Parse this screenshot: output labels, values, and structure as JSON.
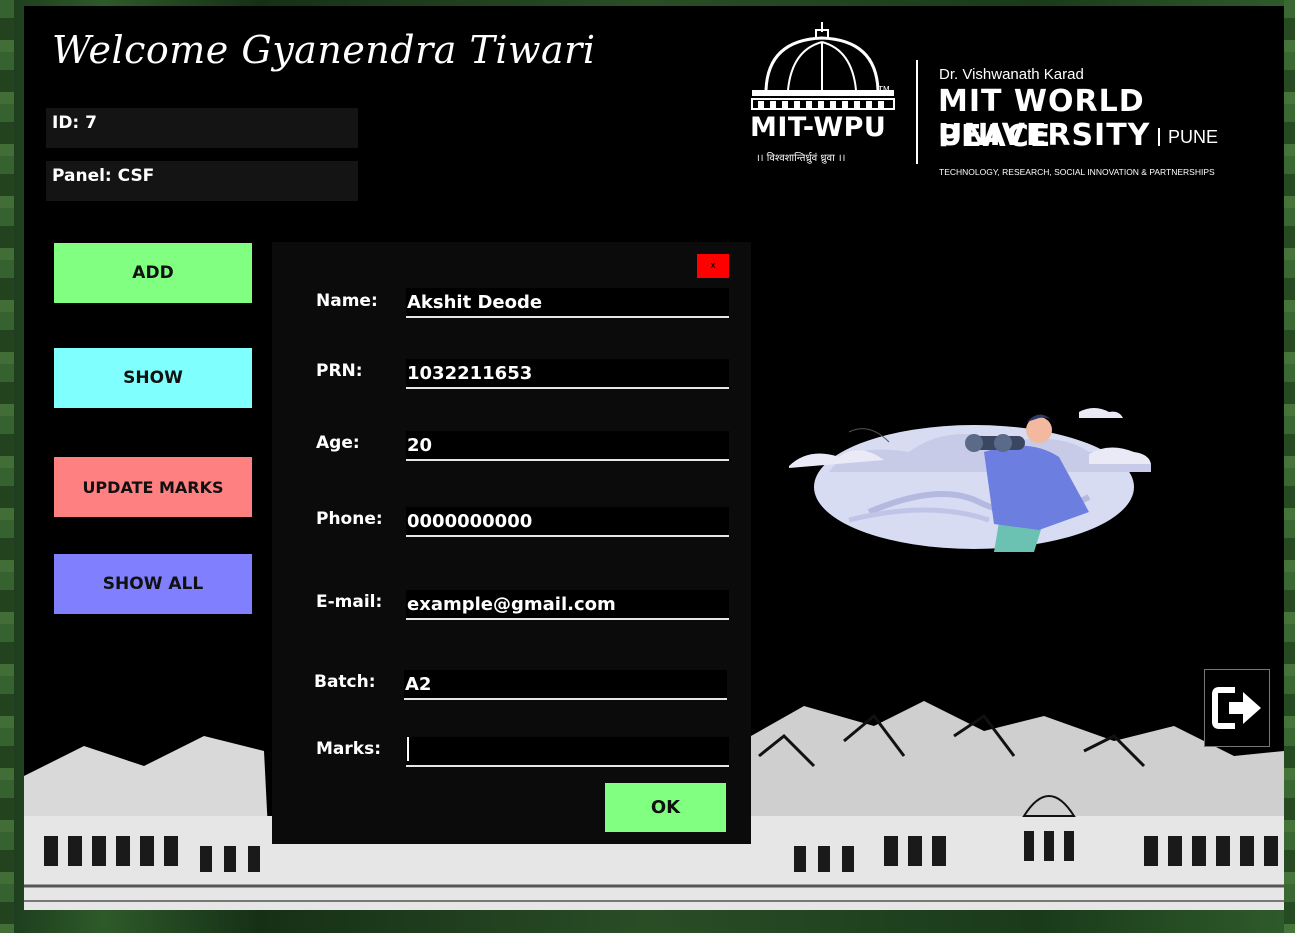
{
  "header": {
    "welcome": "Welcome Gyanendra Tiwari",
    "id": "ID: 7",
    "panel": "Panel: CSF"
  },
  "logo": {
    "mark": "MIT-WPU",
    "motto": "।। विश्वशान्तिर्ध्रुवं ध्रुवा ।।",
    "tm": "TM",
    "karad": "Dr. Vishwanath Karad",
    "university_line1": "MIT WORLD PEACE",
    "university_line2": "UNIVERSITY",
    "city": "PUNE",
    "tagline": "TECHNOLOGY, RESEARCH, SOCIAL INNOVATION & PARTNERSHIPS"
  },
  "sidebar": {
    "buttons": [
      {
        "label": "ADD",
        "color": "#80ff80"
      },
      {
        "label": "SHOW",
        "color": "#80ffff"
      },
      {
        "label": "UPDATE MARKS",
        "color": "#ff8080"
      },
      {
        "label": "SHOW ALL",
        "color": "#8080ff"
      }
    ]
  },
  "dialog": {
    "close_label": "x",
    "fields": {
      "name": {
        "label": "Name:",
        "value": "Akshit Deode"
      },
      "prn": {
        "label": "PRN:",
        "value": "1032211653"
      },
      "age": {
        "label": "Age:",
        "value": "20"
      },
      "phone": {
        "label": "Phone:",
        "value": "0000000000"
      },
      "email": {
        "label": "E-mail:",
        "value": "example@gmail.com"
      },
      "batch": {
        "label": "Batch:",
        "value": "A2"
      },
      "marks": {
        "label": "Marks:",
        "value": ""
      }
    },
    "ok_label": "OK"
  },
  "icons": {
    "exit": "logout-icon",
    "close": "close-icon"
  },
  "colors": {
    "close": "#ff0000",
    "ok": "#80ff80"
  }
}
